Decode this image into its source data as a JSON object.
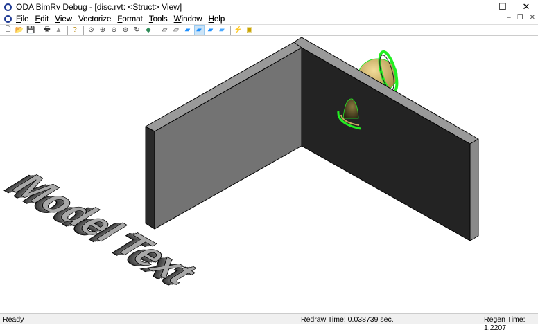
{
  "window": {
    "title": "ODA BimRv Debug - [disc.rvt: <Struct> View]",
    "minimize": "—",
    "maximize": "☐",
    "close": "✕"
  },
  "menu": [
    {
      "label": "File",
      "key": "F",
      "rest": "ile"
    },
    {
      "label": "Edit",
      "key": "E",
      "rest": "dit"
    },
    {
      "label": "View",
      "key": "V",
      "rest": "iew"
    },
    {
      "label": "Vectorize",
      "key": "",
      "rest": "Vectorize"
    },
    {
      "label": "Format",
      "key": "F",
      "rest": "ormat"
    },
    {
      "label": "Tools",
      "key": "T",
      "rest": "ools"
    },
    {
      "label": "Window",
      "key": "W",
      "rest": "indow"
    },
    {
      "label": "Help",
      "key": "H",
      "rest": "elp"
    }
  ],
  "mdi": {
    "minimize": "–",
    "restore": "❐",
    "close": "✕"
  },
  "toolbar": {
    "icons": [
      "new-icon",
      "open-icon",
      "save-icon",
      "print-icon",
      "print-preview-icon",
      "help-icon",
      "zoom-window-icon",
      "zoom-in-icon",
      "zoom-out-icon",
      "zoom-extents-icon",
      "orbit-icon",
      "pan-icon",
      "wireframe-icon",
      "hidden-line-icon",
      "flat-shaded-icon",
      "gouraud-shaded-icon",
      "flat-shaded-edges-icon",
      "gouraud-edges-icon",
      "regen-icon",
      "properties-icon"
    ],
    "active": "gouraud-shaded-icon"
  },
  "viewport": {
    "model_text": "Model Text",
    "colors": {
      "wall_front": "#737373",
      "wall_dark": "#232323",
      "wall_top": "#9a9a9a",
      "highlight": "#22ee22",
      "dome": "#d9b970"
    }
  },
  "status": {
    "ready": "Ready",
    "redraw": "Redraw Time: 0.038739 sec.",
    "regen": "Regen Time: 1.2207"
  }
}
